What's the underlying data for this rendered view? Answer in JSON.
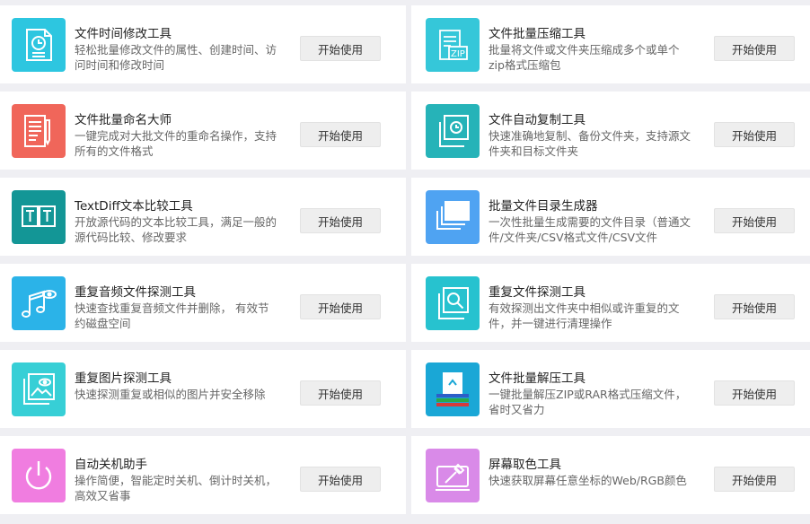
{
  "tools": [
    {
      "title": "文件时间修改工具",
      "desc": "轻松批量修改文件的属性、创建时间、访问时间和修改时间",
      "button": "开始使用",
      "icon": "file-clock-icon",
      "color": "#2dc6e0"
    },
    {
      "title": "文件批量压缩工具",
      "desc": "批量将文件或文件夹压缩成多个或单个zip格式压缩包",
      "button": "开始使用",
      "icon": "zip-icon",
      "color": "#35c7d9"
    },
    {
      "title": "文件批量命名大师",
      "desc": "一键完成对大批文件的重命名操作，支持所有的文件格式",
      "button": "开始使用",
      "icon": "rename-document-pen-icon",
      "color": "#f0665a"
    },
    {
      "title": "文件自动复制工具",
      "desc": "快速准确地复制、备份文件夹，支持源文件夹和目标文件夹",
      "button": "开始使用",
      "icon": "copy-clock-icon",
      "color": "#26b3b8"
    },
    {
      "title": "TextDiff文本比较工具",
      "desc": "开放源代码的文本比较工具，满足一般的源代码比较、修改要求",
      "button": "开始使用",
      "icon": "text-compare-icon",
      "color": "#139696"
    },
    {
      "title": "批量文件目录生成器",
      "desc": "一次性批量生成需要的文件目录（普通文件/文件夹/CSV格式文件/CSV文件",
      "button": "开始使用",
      "icon": "stacked-folders-icon",
      "color": "#4fa3f2"
    },
    {
      "title": "重复音频文件探测工具",
      "desc": "快速查找重复音频文件并删除， 有效节约磁盘空间",
      "button": "开始使用",
      "icon": "music-notes-eye-icon",
      "color": "#2bb3e8"
    },
    {
      "title": "重复文件探测工具",
      "desc": "有效探测出文件夹中相似或许重复的文件，并一键进行清理操作",
      "button": "开始使用",
      "icon": "file-search-icon",
      "color": "#27c2cf"
    },
    {
      "title": "重复图片探测工具",
      "desc": "快速探测重复或相似的图片并安全移除",
      "button": "开始使用",
      "icon": "image-eye-icon",
      "color": "#37cfd6"
    },
    {
      "title": "文件批量解压工具",
      "desc": "一键批量解压ZIP或RAR格式压缩文件，省时又省力",
      "button": "开始使用",
      "icon": "unzip-stack-icon",
      "color": "#1aa7d6"
    },
    {
      "title": "自动关机助手",
      "desc": "操作简便，智能定时关机、倒计时关机，高效又省事",
      "button": "开始使用",
      "icon": "power-icon",
      "color": "#f07de0"
    },
    {
      "title": "屏幕取色工具",
      "desc": "快速获取屏幕任意坐标的Web/RGB颜色",
      "button": "开始使用",
      "icon": "eyedropper-screen-icon",
      "color": "#d98ae8"
    }
  ]
}
